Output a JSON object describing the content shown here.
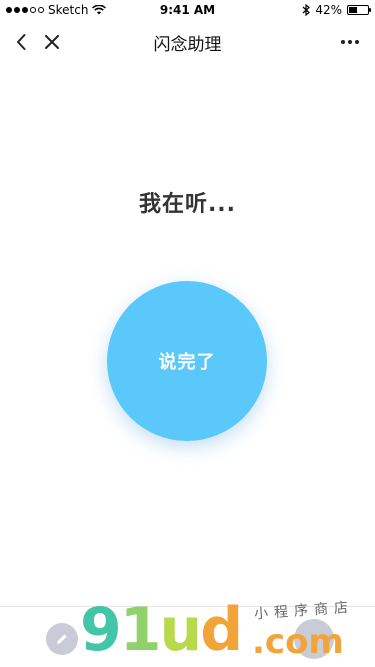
{
  "status_bar": {
    "carrier": "Sketch",
    "time": "9:41 AM",
    "battery": "42%",
    "battery_level": 0.42
  },
  "nav": {
    "title": "闪念助理"
  },
  "main": {
    "listening_text": "我在听...",
    "done_label": "说完了"
  },
  "watermark": {
    "logo_parts": [
      "9",
      "1",
      "u",
      "d"
    ],
    "com": ".com",
    "tagline": "小程序商店"
  },
  "colors": {
    "primary": "#5ac8fa",
    "bottom_button": "#c9ccd6"
  },
  "icons": {
    "back": "chevron-left-icon",
    "close": "close-icon",
    "more": "more-horizontal-icon",
    "wifi": "wifi-icon",
    "bluetooth": "bluetooth-icon",
    "battery": "battery-icon",
    "edit": "pencil-icon"
  }
}
